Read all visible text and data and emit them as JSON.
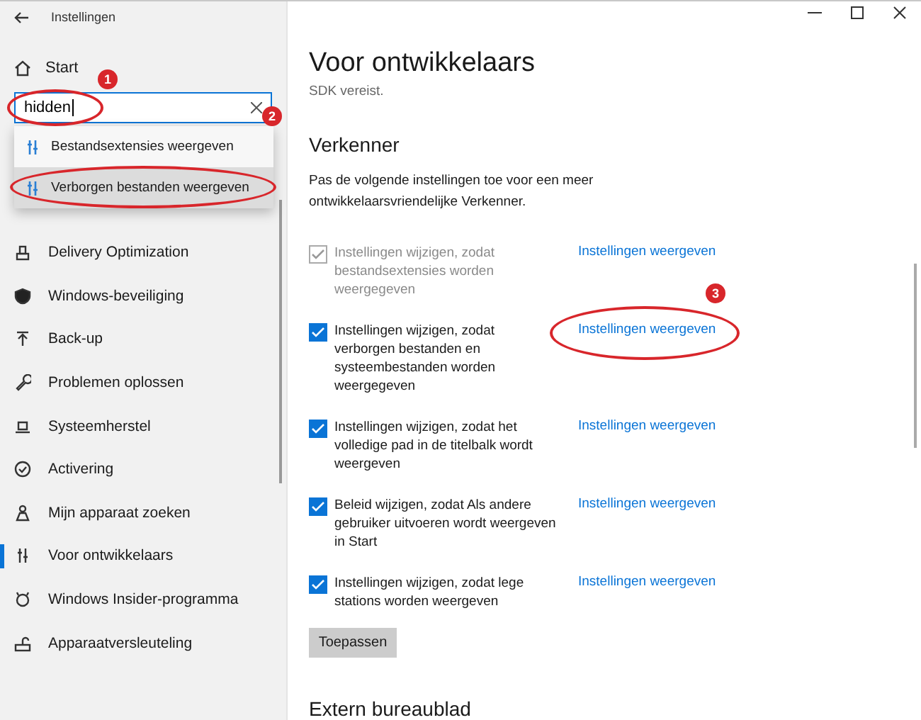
{
  "window": {
    "title": "Instellingen"
  },
  "sidebar": {
    "home": "Start",
    "search": {
      "value": "hidden"
    },
    "suggestions": [
      {
        "label": "Bestandsextensies weergeven",
        "selected": false
      },
      {
        "label": "Verborgen bestanden weergeven",
        "selected": true
      }
    ],
    "items": [
      {
        "label": "Delivery Optimization",
        "selected": false
      },
      {
        "label": "Windows-beveiliging",
        "selected": false
      },
      {
        "label": "Back-up",
        "selected": false
      },
      {
        "label": "Problemen oplossen",
        "selected": false
      },
      {
        "label": "Systeemherstel",
        "selected": false
      },
      {
        "label": "Activering",
        "selected": false
      },
      {
        "label": "Mijn apparaat zoeken",
        "selected": false
      },
      {
        "label": "Voor ontwikkelaars",
        "selected": true
      },
      {
        "label": "Windows Insider-programma",
        "selected": false
      },
      {
        "label": "Apparaatversleuteling",
        "selected": false
      }
    ]
  },
  "main": {
    "title": "Voor ontwikkelaars",
    "subtitle": "SDK vereist.",
    "section": "Verkenner",
    "description": "Pas de volgende instellingen toe voor een meer ontwikkelaarsvriendelijke Verkenner.",
    "settings": [
      {
        "label": "Instellingen wijzigen, zodat bestandsextensies worden weergegeven",
        "checked": true,
        "disabled": true,
        "link": "Instellingen weergeven"
      },
      {
        "label": "Instellingen wijzigen, zodat verborgen bestanden en systeembestanden worden weergegeven",
        "checked": true,
        "disabled": false,
        "link": "Instellingen weergeven"
      },
      {
        "label": "Instellingen wijzigen, zodat het volledige pad in de titelbalk wordt weergeven",
        "checked": true,
        "disabled": false,
        "link": "Instellingen weergeven"
      },
      {
        "label": "Beleid wijzigen, zodat Als andere gebruiker uitvoeren wordt weergeven in Start",
        "checked": true,
        "disabled": false,
        "link": "Instellingen weergeven"
      },
      {
        "label": "Instellingen wijzigen, zodat lege stations worden weergeven",
        "checked": true,
        "disabled": false,
        "link": "Instellingen weergeven"
      }
    ],
    "apply": "Toepassen",
    "next_section": "Extern bureaublad"
  },
  "annotations": [
    {
      "number": "1"
    },
    {
      "number": "2"
    },
    {
      "number": "3"
    }
  ]
}
